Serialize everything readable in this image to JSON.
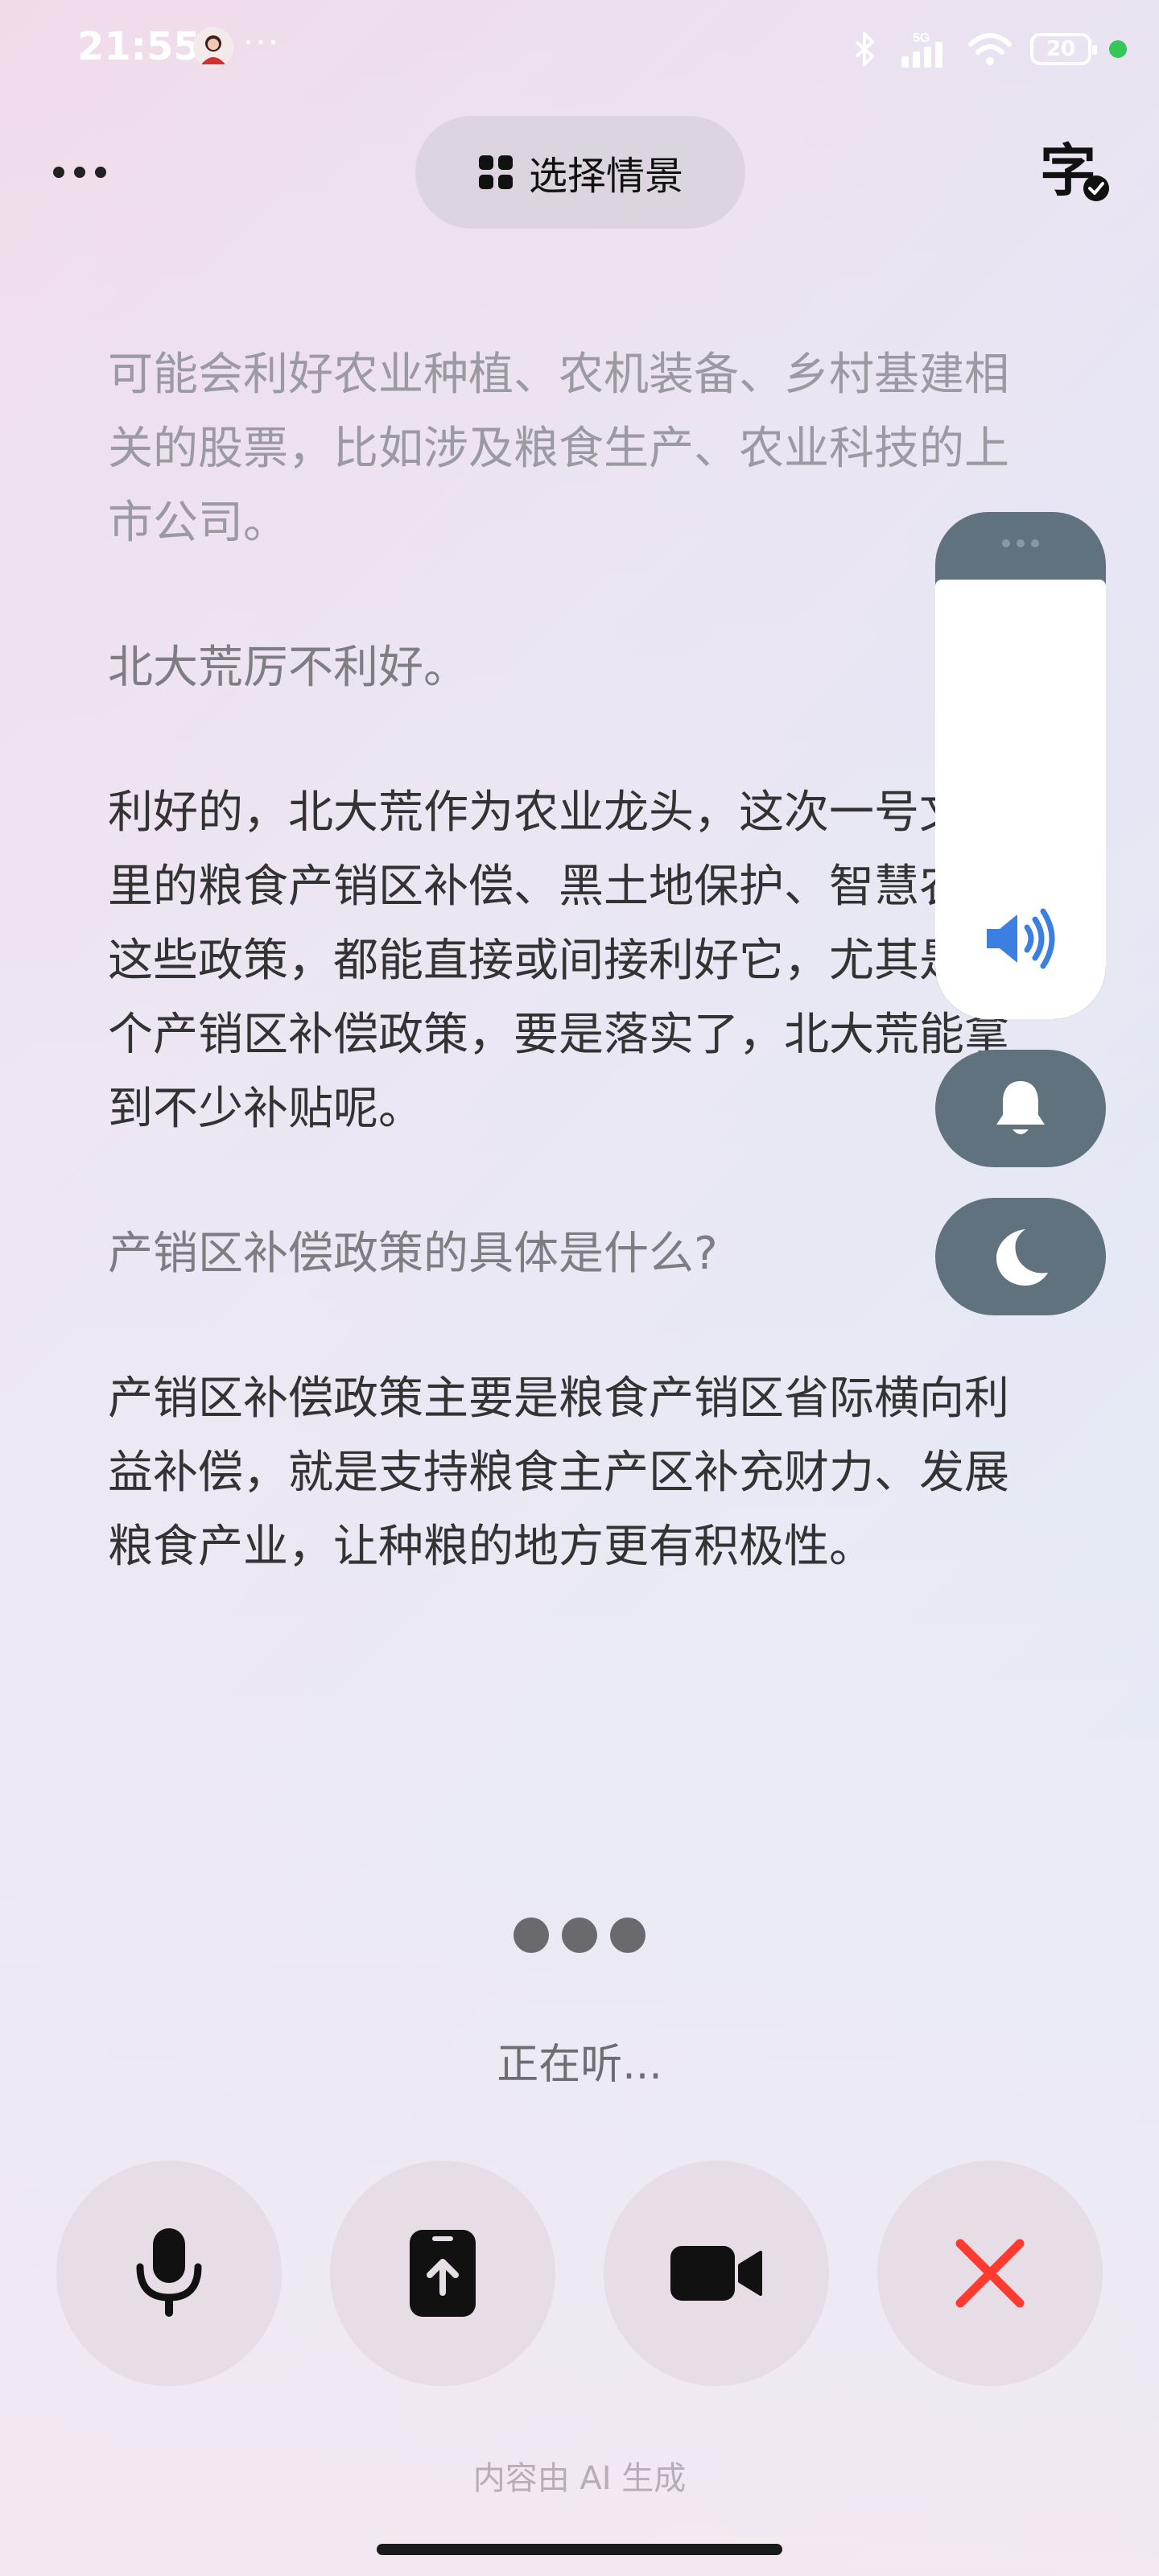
{
  "status_bar": {
    "time": "21:55",
    "more": "···",
    "network": "5G",
    "battery": "20"
  },
  "top_bar": {
    "scene_label": "选择情景",
    "caption_icon": "caption-icon"
  },
  "transcript": [
    {
      "type": "answer",
      "text": "可能会利好农业种植、农机装备、乡村基建相关的股票，比如涉及粮食生产、农业科技的上市公司。"
    },
    {
      "type": "question",
      "text": "北大荒厉不利好。"
    },
    {
      "type": "answer",
      "text": "利好的，北大荒作为农业龙头，这次一号文件里的粮食产销区补偿、黑土地保护、智慧农业这些政策，都能直接或间接利好它，尤其是那个产销区补偿政策，要是落实了，北大荒能拿到不少补贴呢。"
    },
    {
      "type": "question",
      "text": "产销区补偿政策的具体是什么?"
    },
    {
      "type": "answer",
      "text": "产销区补偿政策主要是粮食产销区省际横向利益补偿，就是支持粮食主产区补充财力、发展粮食产业，让种粮的地方更有积极性。"
    }
  ],
  "float_panel": {
    "volume_icon": "speaker-icon",
    "bell_icon": "bell-icon",
    "moon_icon": "moon-icon"
  },
  "status_text": "正在听...",
  "controls": [
    {
      "name": "mic-button",
      "icon": "microphone-icon"
    },
    {
      "name": "share-screen-button",
      "icon": "phone-upload-icon"
    },
    {
      "name": "video-button",
      "icon": "video-camera-icon"
    },
    {
      "name": "hang-up-button",
      "icon": "close-icon"
    }
  ],
  "footer_note": "内容由 AI 生成",
  "colors": {
    "accent_blue": "#3b7fe0",
    "hangup_red": "#ff3b30",
    "panel_slate": "#5f727d"
  }
}
